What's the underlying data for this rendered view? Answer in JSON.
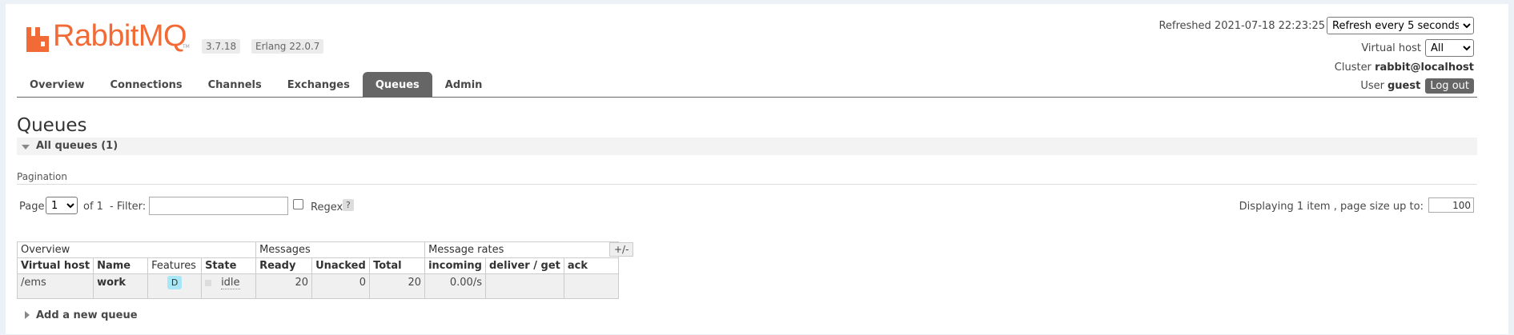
{
  "header": {
    "logo_text": "RabbitMQ",
    "tm": "TM",
    "version": "3.7.18",
    "erlang": "Erlang 22.0.7",
    "refreshed": "Refreshed 2021-07-18 22:23:25",
    "refresh_option": "Refresh every 5 seconds",
    "virtual_host_label": "Virtual host",
    "virtual_host_value": "All",
    "cluster_label": "Cluster",
    "cluster_value": "rabbit@localhost",
    "user_label": "User",
    "user_value": "guest",
    "logout_label": "Log out"
  },
  "tabs": [
    "Overview",
    "Connections",
    "Channels",
    "Exchanges",
    "Queues",
    "Admin"
  ],
  "active_tab": "Queues",
  "page_title": "Queues",
  "section_title": "All queues (1)",
  "pagination": {
    "label": "Pagination",
    "page_label": "Page",
    "page_value": "1",
    "of_label": "of 1",
    "filter_label": "- Filter:",
    "filter_value": "",
    "regex_label": "Regex",
    "help": "?",
    "display_label": "Displaying 1 item , page size up to:",
    "page_size": "100"
  },
  "table": {
    "groups": [
      "Overview",
      "Messages",
      "Message rates"
    ],
    "toggle": "+/-",
    "columns": [
      "Virtual host",
      "Name",
      "Features",
      "State",
      "Ready",
      "Unacked",
      "Total",
      "incoming",
      "deliver / get",
      "ack"
    ],
    "rows": [
      {
        "vhost": "/ems",
        "name": "work",
        "feature": "D",
        "state": "idle",
        "ready": "20",
        "unacked": "0",
        "total": "20",
        "incoming": "0.00/s",
        "deliver": "",
        "ack": ""
      }
    ]
  },
  "add_queue_label": "Add a new queue",
  "colors": {
    "brand": "#f26a35",
    "tab_active": "#666666",
    "feature_badge": "#a8e7f5"
  }
}
